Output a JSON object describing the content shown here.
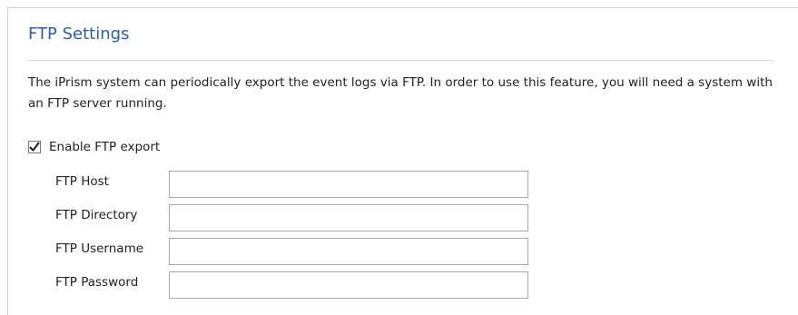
{
  "section": {
    "title": "FTP Settings",
    "description": "The iPrism system can periodically export the event logs via FTP. In order to use this feature, you will need a system with an FTP server running."
  },
  "enable_ftp_export": {
    "label": "Enable FTP export",
    "checked": true
  },
  "fields": {
    "host": {
      "label": "FTP Host",
      "value": ""
    },
    "directory": {
      "label": "FTP Directory",
      "value": ""
    },
    "username": {
      "label": "FTP Username",
      "value": ""
    },
    "password": {
      "label": "FTP Password",
      "value": ""
    }
  },
  "colors": {
    "title": "#2f5f9f",
    "text": "#222222",
    "input_border": "#a8a8a8"
  }
}
